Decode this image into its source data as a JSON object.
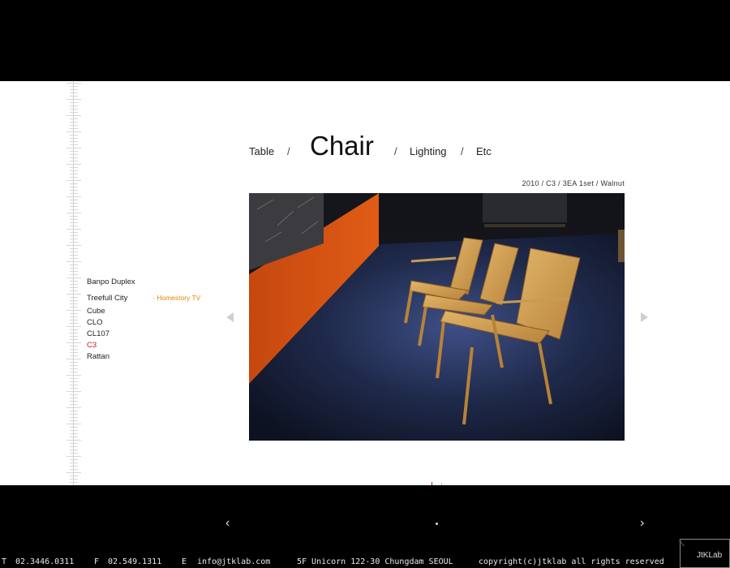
{
  "categories": {
    "table": "Table",
    "chair": "Chair",
    "lighting": "Lighting",
    "etc": "Etc",
    "separator": "/"
  },
  "caption": "2010 / C3 / 3EA 1set / Walnut",
  "projects": {
    "items": [
      {
        "label": "Banpo Duplex"
      },
      {
        "label": "Treefull City",
        "sub": "· Homestory TV"
      },
      {
        "label": "Cube"
      },
      {
        "label": "CLO"
      },
      {
        "label": "CL107"
      },
      {
        "label": "C3"
      },
      {
        "label": "Rattan"
      }
    ],
    "active": "C3"
  },
  "pager": {
    "prev": "‹",
    "next": "›"
  },
  "footer": {
    "tel_label": "T",
    "tel": "02.3446.0311",
    "fax_label": "F",
    "fax": "02.549.1311",
    "email_label": "E",
    "email": "info@jtklab.com",
    "address": "5F Unicorn 122-30 Chungdam SEOUL",
    "copyright": "copyright(c)jtklab all rights reserved"
  },
  "logo": "JtKLab",
  "colors": {
    "active": "#c11d1d",
    "sub_accent": "#e08a00",
    "bar": "#000000"
  }
}
